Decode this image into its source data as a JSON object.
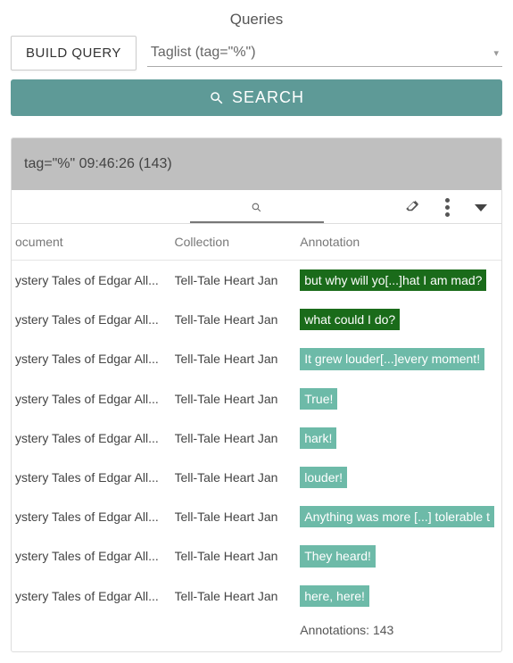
{
  "header": {
    "title": "Queries",
    "build_query_label": "BUILD QUERY",
    "taglist_label": "Taglist (tag=\"%\")",
    "search_label": "SEARCH"
  },
  "results": {
    "summary": "tag=\"%\" 09:46:26 (143)",
    "columns": {
      "document": "ocument",
      "collection": "Collection",
      "annotation": "Annotation"
    },
    "rows": [
      {
        "document": "ystery Tales of Edgar All...",
        "collection": "Tell-Tale Heart Jan",
        "annotation": "but why will yo[...]hat I am mad?",
        "highlight": "dark"
      },
      {
        "document": "ystery Tales of Edgar All...",
        "collection": "Tell-Tale Heart Jan",
        "annotation": "what could I do?",
        "highlight": "dark"
      },
      {
        "document": "ystery Tales of Edgar All...",
        "collection": "Tell-Tale Heart Jan",
        "annotation": "It grew louder[...]every moment!",
        "highlight": "light"
      },
      {
        "document": "ystery Tales of Edgar All...",
        "collection": "Tell-Tale Heart Jan",
        "annotation": "True!",
        "highlight": "light"
      },
      {
        "document": "ystery Tales of Edgar All...",
        "collection": "Tell-Tale Heart Jan",
        "annotation": "hark!",
        "highlight": "light"
      },
      {
        "document": "ystery Tales of Edgar All...",
        "collection": "Tell-Tale Heart Jan",
        "annotation": "louder!",
        "highlight": "light"
      },
      {
        "document": "ystery Tales of Edgar All...",
        "collection": "Tell-Tale Heart Jan",
        "annotation": "Anything was more [...] tolerable t",
        "highlight": "light"
      },
      {
        "document": "ystery Tales of Edgar All...",
        "collection": "Tell-Tale Heart Jan",
        "annotation": "They heard!",
        "highlight": "light"
      },
      {
        "document": "ystery Tales of Edgar All...",
        "collection": "Tell-Tale Heart Jan",
        "annotation": "here, here!",
        "highlight": "light"
      }
    ],
    "footer": "Annotations: 143"
  }
}
